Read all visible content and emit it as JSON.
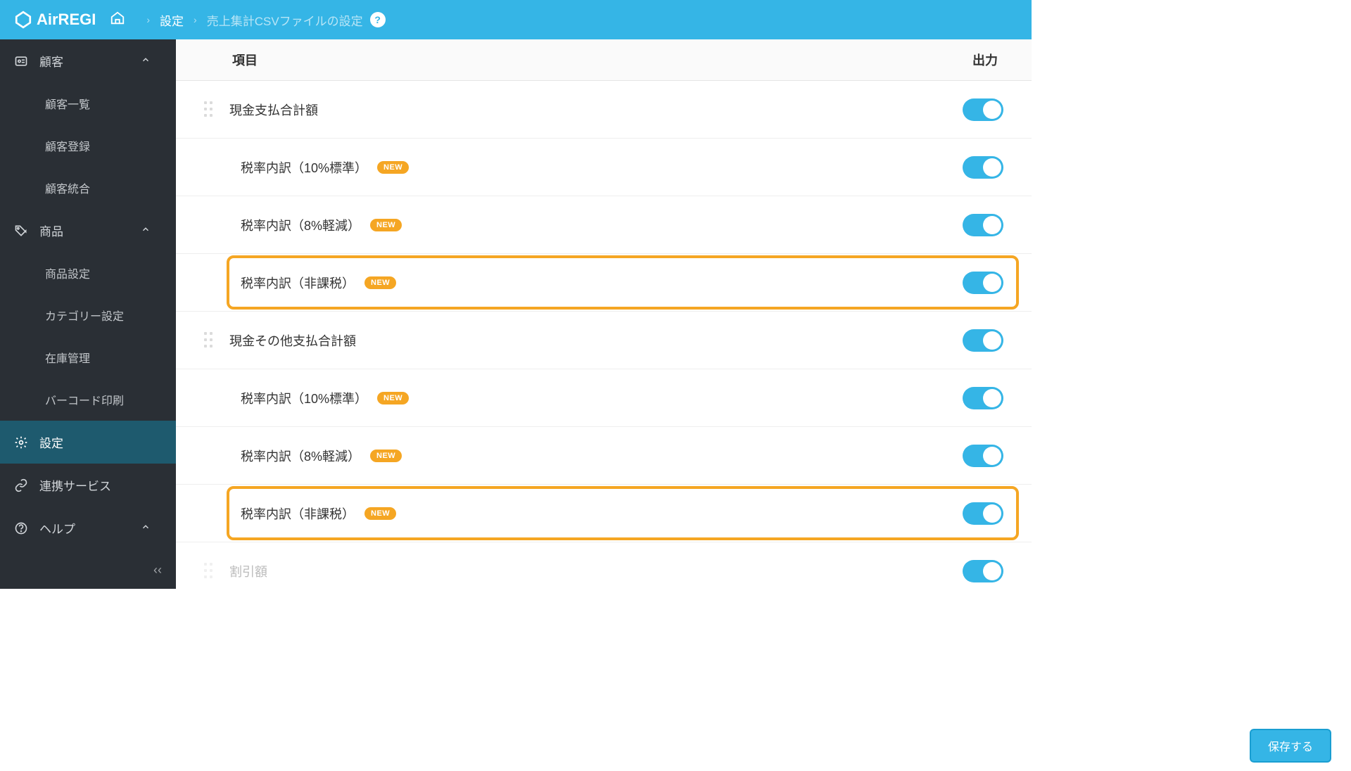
{
  "app": {
    "name": "AirREGI"
  },
  "breadcrumb": {
    "settings": "設定",
    "current": "売上集計CSVファイルの設定"
  },
  "sidebar": {
    "customer": {
      "label": "顧客",
      "items": [
        "顧客一覧",
        "顧客登録",
        "顧客統合"
      ]
    },
    "product": {
      "label": "商品",
      "items": [
        "商品設定",
        "カテゴリー設定",
        "在庫管理",
        "バーコード印刷"
      ]
    },
    "settings": {
      "label": "設定"
    },
    "integration": {
      "label": "連携サービス"
    },
    "help": {
      "label": "ヘルプ"
    }
  },
  "columns": {
    "item": "項目",
    "output": "出力"
  },
  "badge_new": "NEW",
  "rows": [
    {
      "label": "現金支払合計額",
      "parent": true
    },
    {
      "label": "税率内訳（10%標準）",
      "new": true
    },
    {
      "label": "税率内訳（8%軽減）",
      "new": true
    },
    {
      "label": "税率内訳（非課税）",
      "new": true,
      "highlight": true
    },
    {
      "label": "現金その他支払合計額",
      "parent": true
    },
    {
      "label": "税率内訳（10%標準）",
      "new": true
    },
    {
      "label": "税率内訳（8%軽減）",
      "new": true
    },
    {
      "label": "税率内訳（非課税）",
      "new": true,
      "highlight": true
    },
    {
      "label": "割引額",
      "parent": true,
      "dim": true
    }
  ],
  "footer": {
    "save": "保存する"
  }
}
